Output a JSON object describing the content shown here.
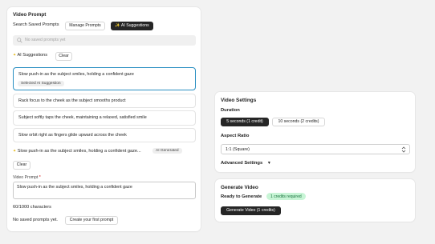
{
  "left_panel": {
    "title": "Video Prompt",
    "search_label": "Search Saved Prompts",
    "manage_button": "Manage Prompts",
    "ai_button": "AI Suggestions",
    "search_placeholder": "No saved prompts yet",
    "ai_suggestions_label": "AI Suggestions",
    "clear_button": "Clear",
    "suggestions": [
      {
        "text": "Slow push-in as the subject smiles, holding a confident gaze",
        "tag": "Selected AI Suggestion",
        "selected": true
      },
      {
        "text": "Rack focus to the cheek as the subject smooths product",
        "selected": false
      },
      {
        "text": "Subject softly taps the cheek, maintaining a relaxed, satisfied smile",
        "selected": false
      },
      {
        "text": "Slow orbit right as fingers glide upward across the cheek",
        "selected": false
      }
    ],
    "generated_text": "Slow push-in as the subject smiles, holding a confident gaze...",
    "generated_tag": "AI Generated",
    "clear_button_2": "Clear",
    "prompt_label": "Video Prompt",
    "required_mark": "*",
    "prompt_value": "Slow push-in as the subject smiles, holding a confident gaze",
    "char_count": "60/1000 characters",
    "no_saved": "No saved prompts yet.",
    "create_button": "Create your first prompt"
  },
  "settings": {
    "title": "Video Settings",
    "duration_label": "Duration",
    "duration_options": [
      "5 seconds (1 credit)",
      "10 seconds (2 credits)"
    ],
    "duration_selected": "5 seconds (1 credit)",
    "aspect_label": "Aspect Ratio",
    "aspect_value": "1:1 (Square)",
    "advanced_label": "Advanced Settings",
    "advanced_arrow": "▼"
  },
  "generate": {
    "title": "Generate Video",
    "ready_label": "Ready to Generate",
    "credits_badge": "1 credits required",
    "button": "Generate Video (1 credits)"
  },
  "colors": {
    "accent_selected": "#2a8fc2",
    "dark_button": "#262626",
    "badge_green_bg": "#c8f5d6",
    "badge_green_text": "#15703a",
    "sparkle": "#e2b400"
  },
  "icons": {
    "search": "search-icon",
    "sparkle": "sparkle-icon",
    "chevron": "chevron-updown-icon"
  }
}
